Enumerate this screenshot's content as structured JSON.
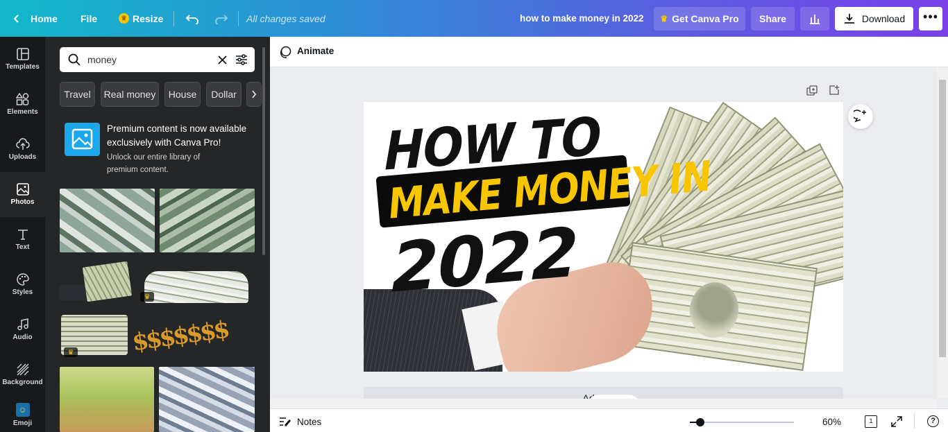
{
  "topbar": {
    "home_label": "Home",
    "file_label": "File",
    "resize_label": "Resize",
    "save_status": "All changes saved",
    "doc_title": "how to make money in 2022",
    "pro_label": "Get Canva Pro",
    "share_label": "Share",
    "download_label": "Download"
  },
  "rail": {
    "items": [
      {
        "label": "Templates"
      },
      {
        "label": "Elements"
      },
      {
        "label": "Uploads"
      },
      {
        "label": "Photos"
      },
      {
        "label": "Text"
      },
      {
        "label": "Styles"
      },
      {
        "label": "Audio"
      },
      {
        "label": "Background"
      },
      {
        "label": "Emoji"
      }
    ],
    "active": "Photos"
  },
  "panel": {
    "search_value": "money",
    "chips": [
      "Travel",
      "Real money",
      "House",
      "Dollar"
    ],
    "promo_title": "Premium content is now available exclusively with Canva Pro!",
    "promo_sub": "Unlock our entire library of premium content."
  },
  "toolbar": {
    "animate_label": "Animate"
  },
  "design": {
    "line1": "HOW TO",
    "line2": "MAKE MONEY IN",
    "line3": "2022"
  },
  "canvas": {
    "add_page_label": "Add page"
  },
  "bottom": {
    "notes_label": "Notes",
    "zoom": "60%",
    "page_count": "1"
  },
  "colors": {
    "accent_yellow": "#f7c600",
    "brand_teal": "#12b8c9",
    "brand_purple": "#7a40e8"
  }
}
